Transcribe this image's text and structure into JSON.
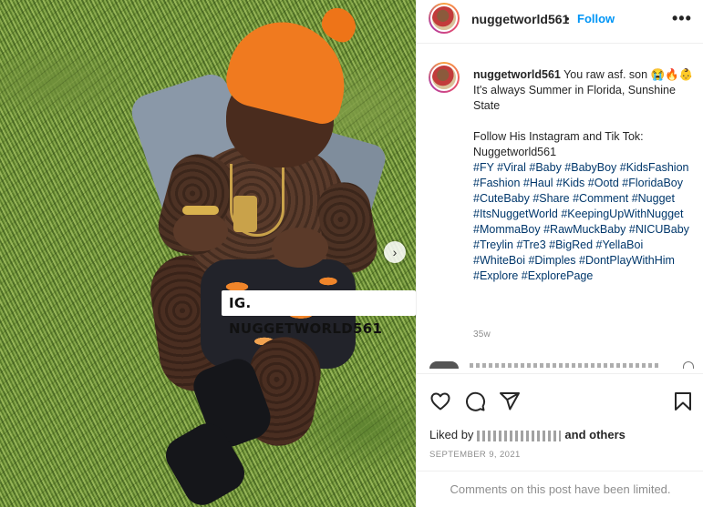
{
  "photo": {
    "watermark": "IG. NUGGETWORLD561",
    "next_glyph": "›"
  },
  "header": {
    "username": "nuggetworld561",
    "separator": "•",
    "follow_label": "Follow",
    "more_glyph": "•••"
  },
  "caption": {
    "username": "nuggetworld561",
    "line1": "You raw asf. son 😭🔥👶",
    "line2": "It's always Summer in Florida, Sunshine State",
    "line3": "Follow His Instagram and Tik Tok:",
    "line4": "Nuggetworld561",
    "hashtags": "#FY #Viral #Baby #BabyBoy #KidsFashion #Fashion #Haul #Kids #Ootd #FloridaBoy #CuteBaby #Share #Comment #Nugget #ItsNuggetWorld #KeepingUpWithNugget #MommaBoy #RawMuckBaby #NICUBaby #Treylin #Tre3 #BigRed #YellaBoi #WhiteBoi #Dimples #DontPlayWithHim #Explore #ExplorePage",
    "time": "35w"
  },
  "actions": {
    "icons": [
      "heart-icon",
      "comment-icon",
      "share-icon",
      "bookmark-icon"
    ]
  },
  "likes": {
    "prefix": "Liked by",
    "suffix": "and others"
  },
  "date": "SEPTEMBER 9, 2021",
  "comments_notice": "Comments on this post have been limited."
}
